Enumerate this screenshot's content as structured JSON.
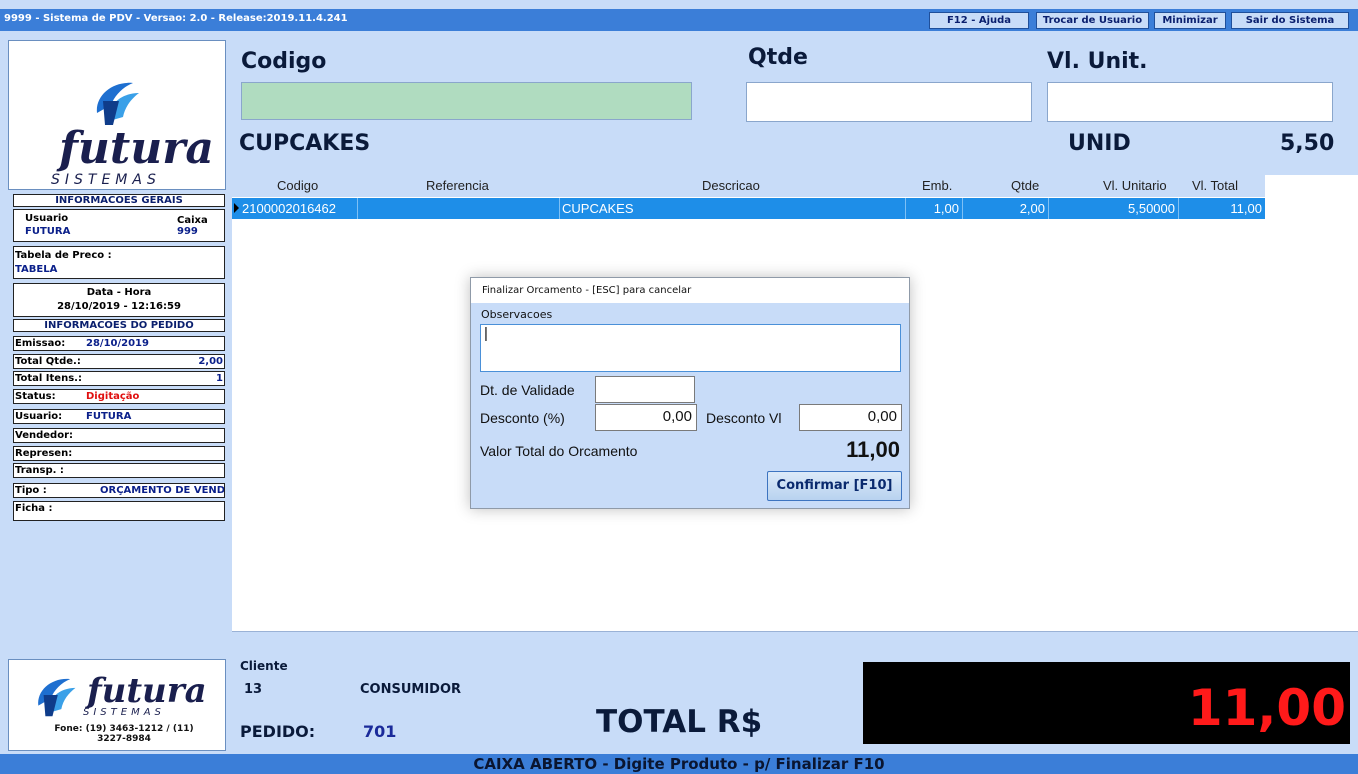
{
  "titlebar": {
    "title": "9999 - Sistema de PDV - Versao: 2.0 - Release:2019.11.4.241",
    "buttons": [
      "F12 - Ajuda",
      "Trocar de Usuario",
      "Minimizar",
      "Sair do Sistema"
    ]
  },
  "logo": {
    "brand": "futura",
    "sub": "SISTEMAS",
    "phone": "Fone: (19) 3463-1212 / (11) 3227-8984"
  },
  "info_gerais": {
    "header": "INFORMACOES GERAIS",
    "usuario_label": "Usuario",
    "usuario_value": "FUTURA",
    "caixa_label": "Caixa",
    "caixa_value": "999",
    "tabela_label": "Tabela de Preco :",
    "tabela_value": "TABELA",
    "datahora_label": "Data - Hora",
    "datahora_value": "28/10/2019 - 12:16:59"
  },
  "info_pedido": {
    "header": "INFORMACOES DO PEDIDO",
    "rows": [
      {
        "label": "Emissao:",
        "value": "28/10/2019"
      },
      {
        "label": "Total Qtde.:",
        "value": "2,00"
      },
      {
        "label": "Total Itens.:",
        "value": "1"
      },
      {
        "label": "Status:",
        "value": "Digitação"
      },
      {
        "label": "Usuario:",
        "value": "FUTURA"
      },
      {
        "label": "Vendedor:",
        "value": ""
      },
      {
        "label": "Represen:",
        "value": ""
      },
      {
        "label": "Transp. :",
        "value": ""
      },
      {
        "label": "Tipo :",
        "value": "ORÇAMENTO DE VENDAS"
      },
      {
        "label": "Ficha :",
        "value": ""
      }
    ]
  },
  "header": {
    "codigo_label": "Codigo",
    "qtde_label": "Qtde",
    "vlunit_label": "Vl. Unit.",
    "codigo_value": "",
    "qtde_value": "",
    "vlunit_value": "",
    "product_name": "CUPCAKES",
    "unit": "UNID",
    "price": "5,50"
  },
  "grid": {
    "columns": [
      "Codigo",
      "Referencia",
      "Descricao",
      "Emb.",
      "Qtde",
      "Vl. Unitario",
      "Vl. Total"
    ],
    "rows": [
      {
        "codigo": "2100002016462",
        "referencia": "",
        "descricao": "CUPCAKES",
        "emb": "1,00",
        "qtde": "2,00",
        "vl_unitario": "5,50000",
        "vl_total": "11,00"
      }
    ]
  },
  "dialog": {
    "title": "Finalizar Orcamento - [ESC] para cancelar",
    "observacoes_label": "Observacoes",
    "observacoes_value": "|",
    "validade_label": "Dt. de Validade",
    "validade_value": "",
    "desconto_pct_label": "Desconto (%)",
    "desconto_pct_value": "0,00",
    "desconto_vl_label": "Desconto Vl",
    "desconto_vl_value": "0,00",
    "valor_total_label": "Valor Total do Orcamento",
    "valor_total_value": "11,00",
    "confirm_label": "Confirmar [F10]"
  },
  "bottom": {
    "cliente_label": "Cliente",
    "cliente_code": "13",
    "cliente_name": "CONSUMIDOR",
    "pedido_label": "PEDIDO:",
    "pedido_value": "701",
    "total_label": "TOTAL R$",
    "total_value": "11,00"
  },
  "statusbar": {
    "text": "CAIXA ABERTO - Digite Produto - p/ Finalizar F10"
  },
  "colors": {
    "titlebar": "#3b7ed8",
    "panel": "#c8dcf8",
    "selected_row": "#1e8ee8",
    "codigo_input": "#b0dcc0",
    "total_text": "#ff1a1a",
    "status_red": "#e01010"
  }
}
